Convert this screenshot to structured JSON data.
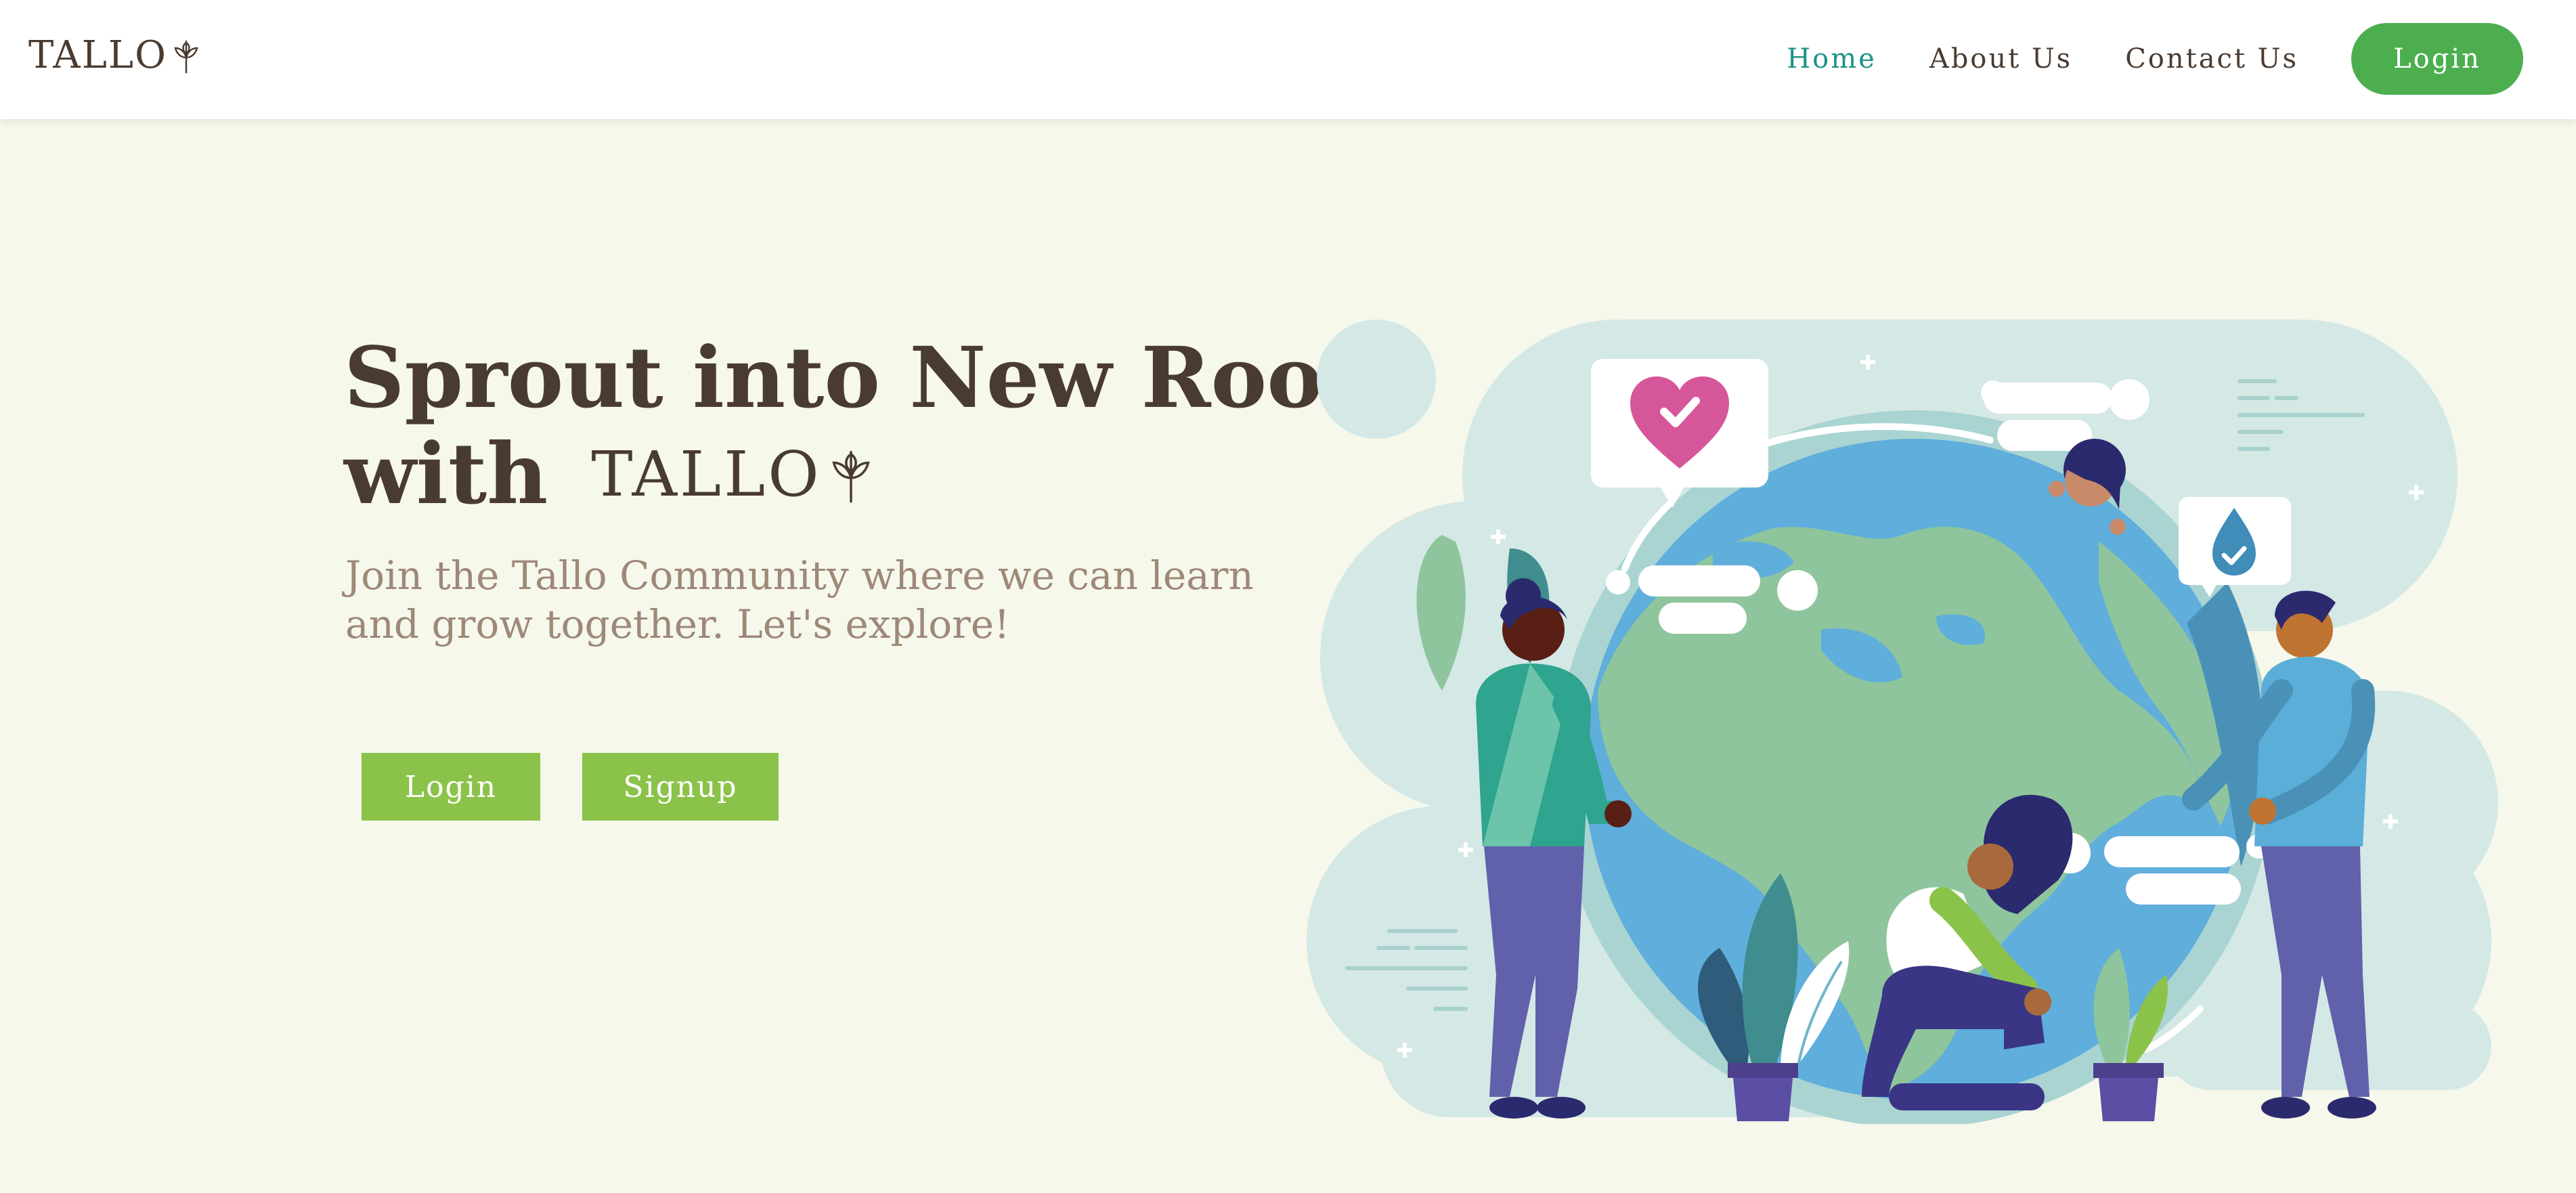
{
  "header": {
    "brand": "TALLO",
    "nav": {
      "home": "Home",
      "about": "About Us",
      "contact": "Contact Us",
      "login": "Login"
    }
  },
  "hero": {
    "title_line1": "Sprout into New Roots",
    "title_line2_prefix": "with",
    "title_brand": "TALLO",
    "subtitle": "Join the Tallo Community where we can learn and grow together. Let's explore!",
    "login_button": "Login",
    "signup_button": "Signup"
  },
  "icons": {
    "brand": "leaf-icon",
    "illustration_badges": [
      "heart-check-icon",
      "water-drop-check-icon"
    ]
  },
  "colors": {
    "background": "#f5f8ea",
    "text": "#4a3b30",
    "subtitle": "#9e8878",
    "nav_active": "#1a9386",
    "nav_login": "#4cae4f",
    "hero_buttons": "#8bc34a"
  }
}
